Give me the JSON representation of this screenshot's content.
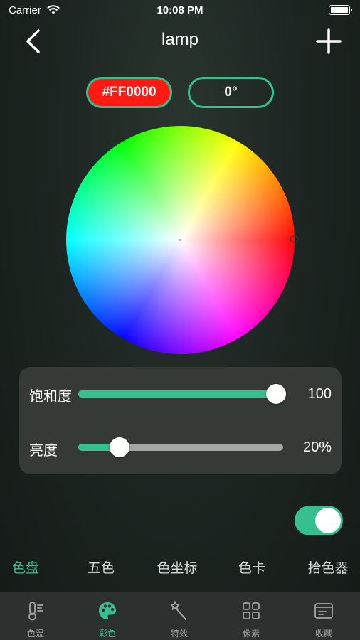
{
  "status_bar": {
    "carrier": "Carrier",
    "time": "10:08 PM"
  },
  "header": {
    "title": "lamp",
    "back_icon": "chevron-left-icon",
    "add_icon": "plus-icon"
  },
  "color": {
    "hex": "#FF0000",
    "angle": "0°"
  },
  "sliders": {
    "saturation": {
      "label": "饱和度",
      "value_text": "100",
      "fraction": 1.0
    },
    "brightness": {
      "label": "亮度",
      "value_text": "20%",
      "fraction": 0.2
    }
  },
  "toggle": {
    "on": true
  },
  "mode_tabs": [
    {
      "label": "色盘",
      "active": true
    },
    {
      "label": "五色",
      "active": false
    },
    {
      "label": "色坐标",
      "active": false
    },
    {
      "label": "色卡",
      "active": false
    },
    {
      "label": "拾色器",
      "active": false
    }
  ],
  "bottom_nav": [
    {
      "label": "色温",
      "icon": "thermometer-icon",
      "active": false
    },
    {
      "label": "彩色",
      "icon": "palette-icon",
      "active": true
    },
    {
      "label": "特效",
      "icon": "magic-wand-icon",
      "active": false
    },
    {
      "label": "像素",
      "icon": "grid-icon",
      "active": false
    },
    {
      "label": "收藏",
      "icon": "bookmark-card-icon",
      "active": false
    }
  ],
  "colors": {
    "accent": "#37c08f",
    "hex_pill_bg": "#ff1a12",
    "panel": "#353a37",
    "nav_bg": "#2c302e"
  }
}
